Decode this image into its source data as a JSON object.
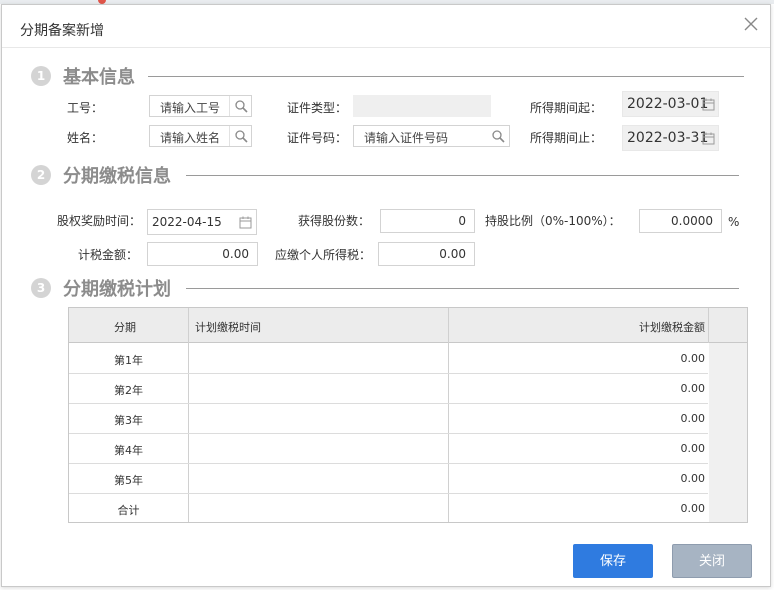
{
  "dialog": {
    "title": "分期备案新增",
    "close_glyph": "×"
  },
  "sections": {
    "basic": {
      "num": "1",
      "title": "基本信息"
    },
    "installment": {
      "num": "2",
      "title": "分期缴税信息"
    },
    "plan": {
      "num": "3",
      "title": "分期缴税计划"
    }
  },
  "basic": {
    "emp_no_label": "工号：",
    "emp_no_placeholder": "请输入工号",
    "name_label": "姓名：",
    "name_placeholder": "请输入姓名",
    "id_type_label": "证件类型：",
    "id_type_value": "",
    "id_no_label": "证件号码：",
    "id_no_placeholder": "请输入证件号码",
    "period_start_label": "所得期间起：",
    "period_start_value": "2022-03-01",
    "period_end_label": "所得期间止：",
    "period_end_value": "2022-03-31"
  },
  "installment": {
    "grant_date_label": "股权奖励时间：",
    "grant_date_value": "2022-04-15",
    "shares_label": "获得股份数：",
    "shares_value": "0",
    "ratio_label": "持股比例（0%-100%）：",
    "ratio_value": "0.0000",
    "ratio_unit": "%",
    "taxable_label": "计税金额：",
    "taxable_value": "0.00",
    "tax_due_label": "应缴个人所得税：",
    "tax_due_value": "0.00"
  },
  "plan": {
    "columns": [
      "分期",
      "计划缴税时间",
      "计划缴税金额"
    ],
    "rows": [
      {
        "period": "第1年",
        "date": "",
        "amount": "0.00"
      },
      {
        "period": "第2年",
        "date": "",
        "amount": "0.00"
      },
      {
        "period": "第3年",
        "date": "",
        "amount": "0.00"
      },
      {
        "period": "第4年",
        "date": "",
        "amount": "0.00"
      },
      {
        "period": "第5年",
        "date": "",
        "amount": "0.00"
      },
      {
        "period": "合计",
        "date": "",
        "amount": "0.00"
      }
    ]
  },
  "buttons": {
    "save": "保存",
    "close": "关闭"
  },
  "icons": {
    "search": "search-icon",
    "calendar": "calendar-icon",
    "close": "close-icon"
  },
  "colors": {
    "primary": "#2f7be0",
    "disabled_button": "#a7b4c3",
    "section_text": "#8c8c8c"
  }
}
